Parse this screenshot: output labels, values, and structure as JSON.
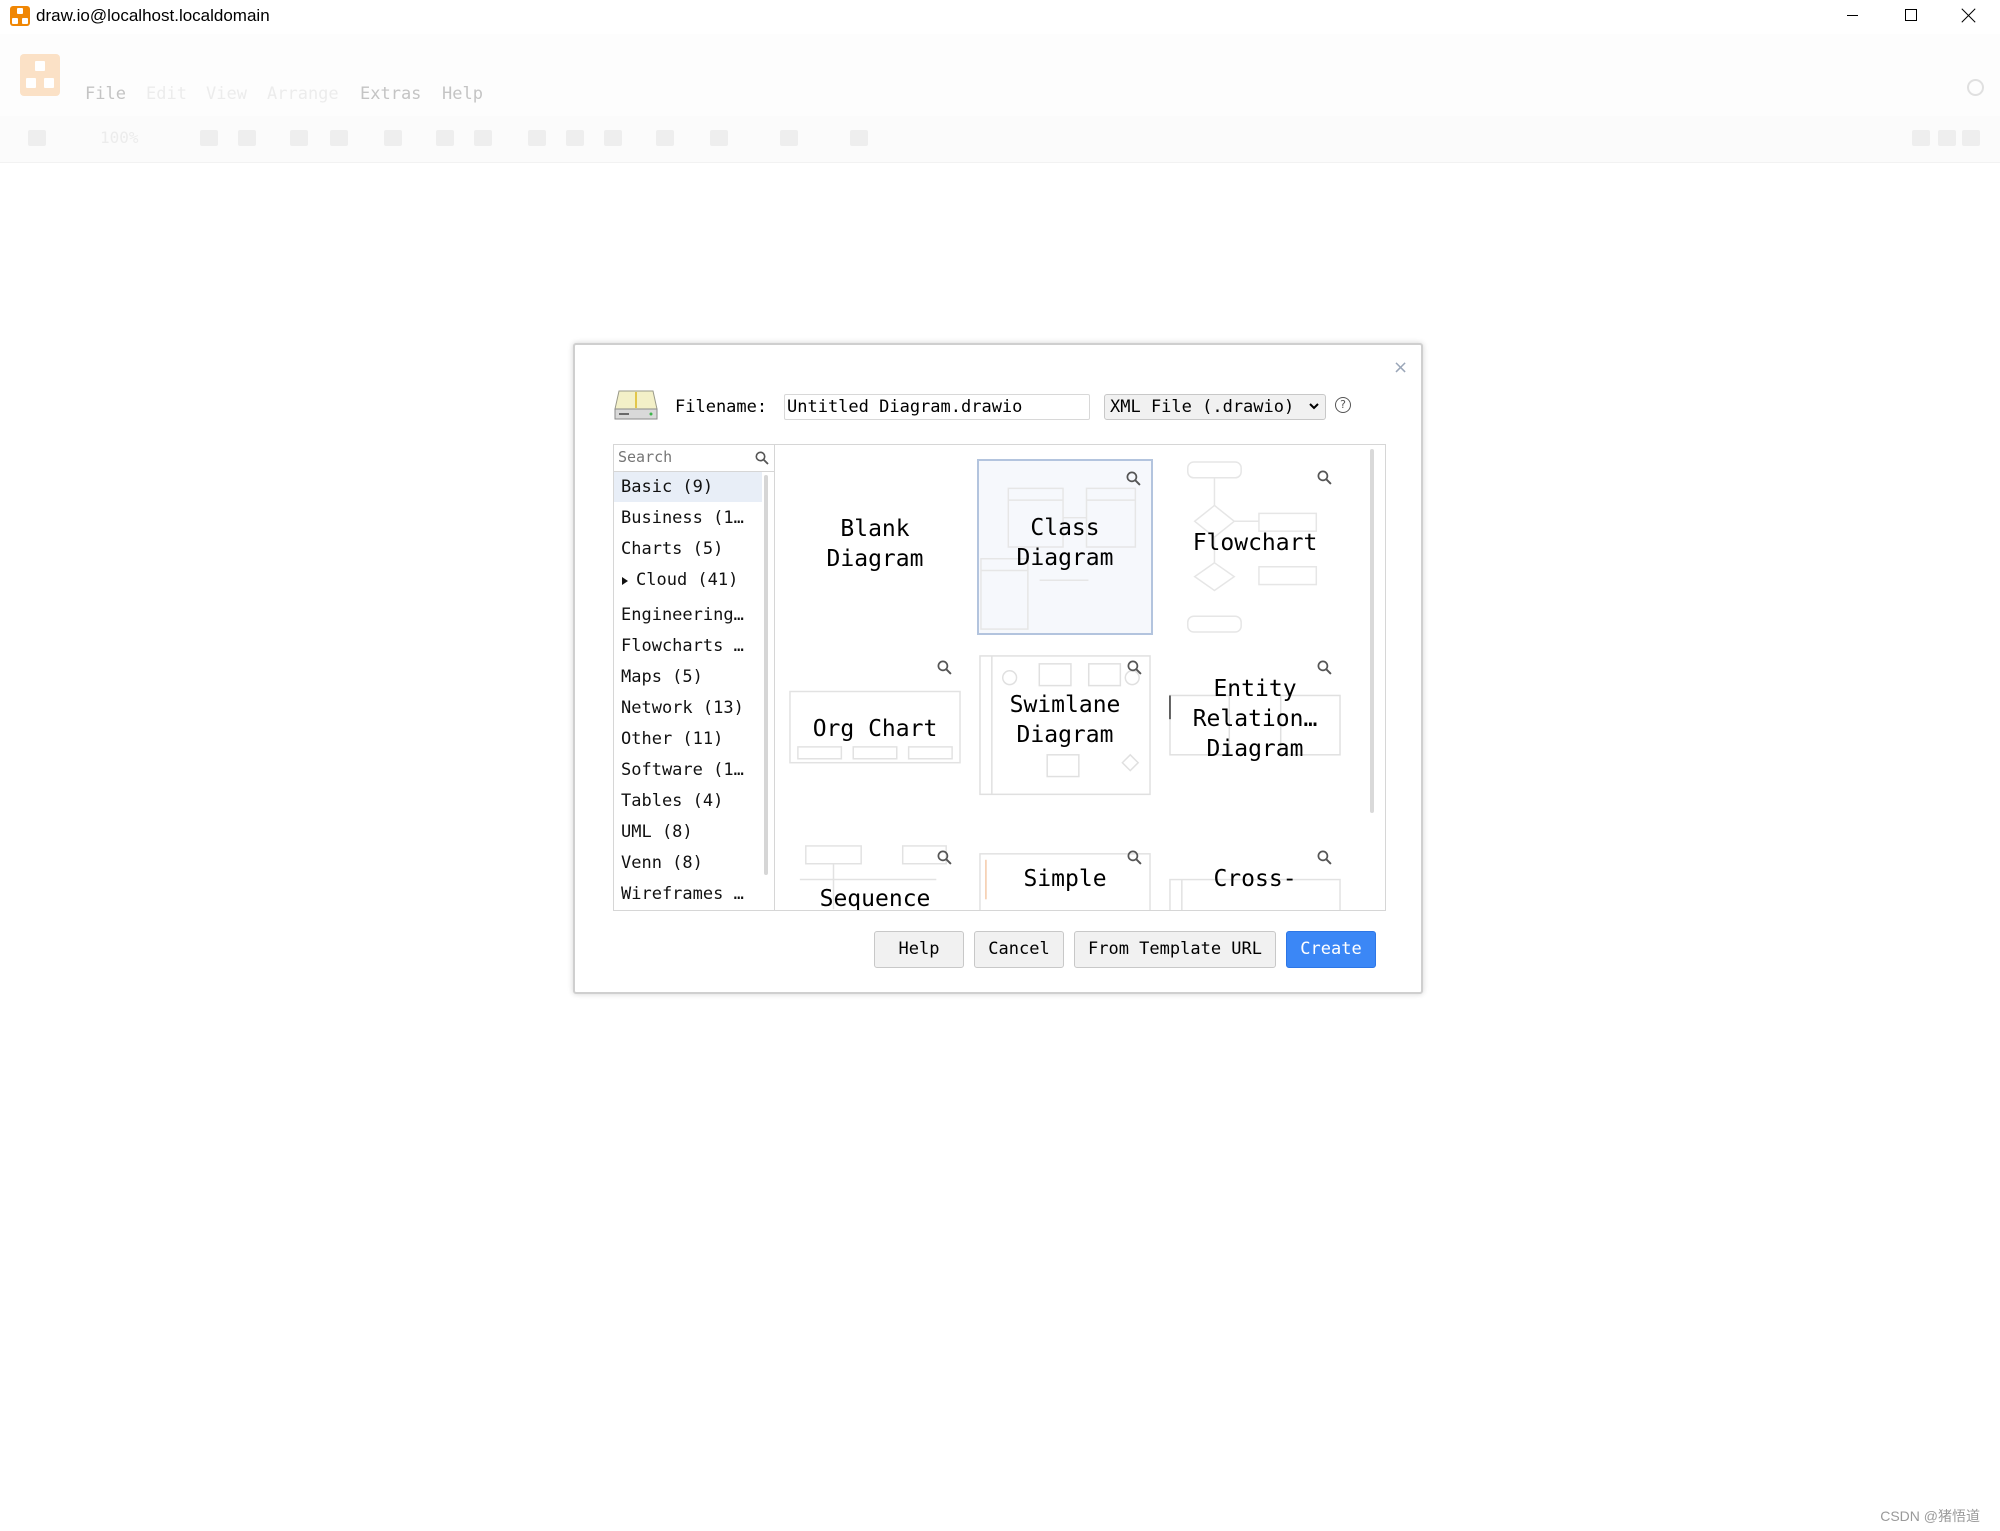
{
  "window": {
    "title": "draw.io@localhost.localdomain"
  },
  "menubar": {
    "items": [
      "File",
      "Edit",
      "View",
      "Arrange",
      "Extras",
      "Help"
    ]
  },
  "toolbar": {
    "zoom": "100%"
  },
  "dialog": {
    "filename_label": "Filename:",
    "filename_value": "Untitled Diagram.drawio",
    "format_selected": "XML File (.drawio)",
    "help_icon_text": "?",
    "close_symbol": "×",
    "search_placeholder": "Search",
    "categories": [
      "Basic (9)",
      "Business (1…",
      "Charts (5)",
      "Cloud (41)",
      "Engineering…",
      "Flowcharts …",
      "Maps (5)",
      "Network (13)",
      "Other (11)",
      "Software (1…",
      "Tables (4)",
      "UML (8)",
      "Venn (8)",
      "Wireframes …"
    ],
    "selected_category": "Basic (9)",
    "templates": [
      {
        "l1": "Blank",
        "l2": "Diagram"
      },
      {
        "l1": "Class",
        "l2": "Diagram"
      },
      {
        "l1": "Flowchart",
        "l2": ""
      },
      {
        "l1": "Org Chart",
        "l2": ""
      },
      {
        "l1": "Swimlane",
        "l2": "Diagram"
      },
      {
        "l1": "Entity",
        "l2": "Relation…",
        "l3": "Diagram"
      },
      {
        "l1": "Sequence",
        "l2": ""
      },
      {
        "l1": "Simple",
        "l2": ""
      },
      {
        "l1": "Cross-",
        "l2": ""
      }
    ],
    "selected_template": "Class Diagram",
    "buttons": {
      "help": "Help",
      "cancel": "Cancel",
      "from_url": "From Template URL",
      "create": "Create"
    }
  },
  "watermark": "CSDN @猪悟道",
  "colors": {
    "primary": "#3b87f6",
    "drawio_orange": "#f08705",
    "selection": "#e8eef7"
  }
}
